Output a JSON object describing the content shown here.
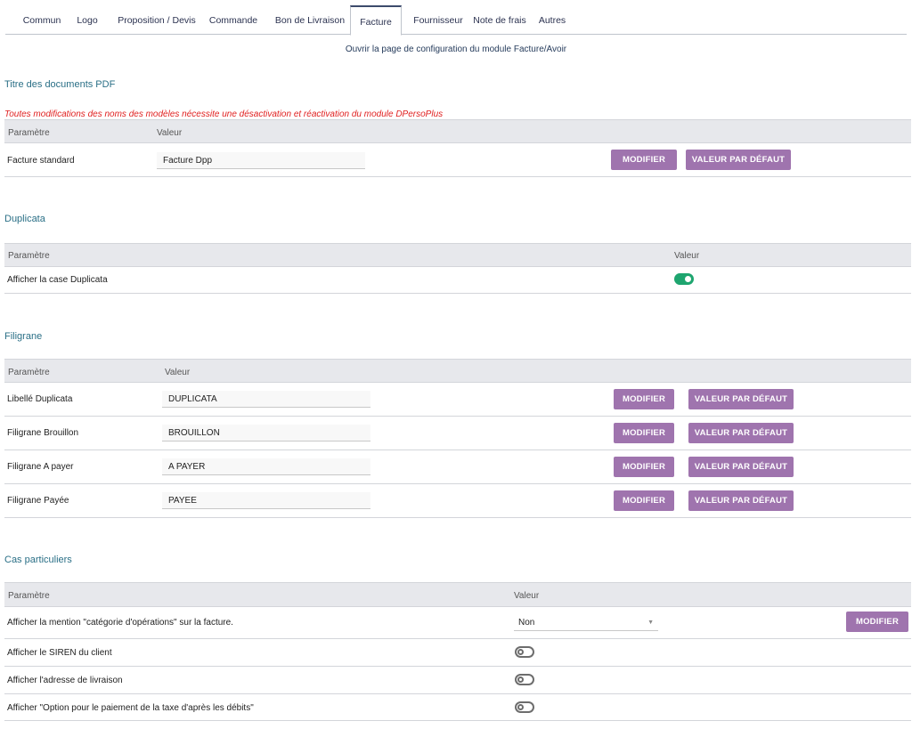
{
  "tabs": [
    {
      "label": "Commun"
    },
    {
      "label": "Logo"
    },
    {
      "label": "Proposition / Devis"
    },
    {
      "label": "Commande"
    },
    {
      "label": "Bon de Livraison"
    },
    {
      "label": "Facture",
      "active": true
    },
    {
      "label": "Fournisseur"
    },
    {
      "label": "Note de frais"
    },
    {
      "label": "Autres"
    }
  ],
  "config_link": "Ouvrir la page de configuration du module Facture/Avoir",
  "pdf_titles": {
    "title": "Titre des documents PDF",
    "warning": "Toutes modifications des noms des modèles nécessite une désactivation et réactivation du module DPersoPlus",
    "col_param": "Paramètre",
    "col_value": "Valeur",
    "rows": [
      {
        "label": "Facture standard",
        "value": "Facture Dpp",
        "modify": "MODIFIER",
        "default": "VALEUR PAR DÉFAUT"
      }
    ]
  },
  "duplicata": {
    "title": "Duplicata",
    "col_param": "Paramètre",
    "col_value": "Valeur",
    "rows": [
      {
        "label": "Afficher la case Duplicata",
        "toggle": "on"
      }
    ]
  },
  "filigrane": {
    "title": "Filigrane",
    "col_param": "Paramètre",
    "col_value": "Valeur",
    "rows": [
      {
        "label": "Libellé Duplicata",
        "value": "DUPLICATA",
        "modify": "MODIFIER",
        "default": "VALEUR PAR DÉFAUT"
      },
      {
        "label": "Filigrane Brouillon",
        "value": "BROUILLON",
        "modify": "MODIFIER",
        "default": "VALEUR PAR DÉFAUT"
      },
      {
        "label": "Filigrane A payer",
        "value": "A PAYER",
        "modify": "MODIFIER",
        "default": "VALEUR PAR DÉFAUT"
      },
      {
        "label": "Filigrane Payée",
        "value": "PAYEE",
        "modify": "MODIFIER",
        "default": "VALEUR PAR DÉFAUT"
      }
    ]
  },
  "cas": {
    "title": "Cas particuliers",
    "col_param": "Paramètre",
    "col_value": "Valeur",
    "rows": [
      {
        "label": "Afficher la mention \"catégorie d'opérations\" sur la facture.",
        "select": "Non",
        "modify": "MODIFIER"
      },
      {
        "label": "Afficher le SIREN du client",
        "toggle": "off"
      },
      {
        "label": "Afficher l'adresse de livraison",
        "toggle": "off"
      },
      {
        "label": "Afficher \"Option pour le paiement de la taxe d'après les débits\"",
        "toggle": "off"
      }
    ]
  },
  "colors": {
    "accent_button": "#9f74ae",
    "section_title": "#2a6f86",
    "toggle_on": "#1ea56f",
    "warning": "#e02020"
  }
}
